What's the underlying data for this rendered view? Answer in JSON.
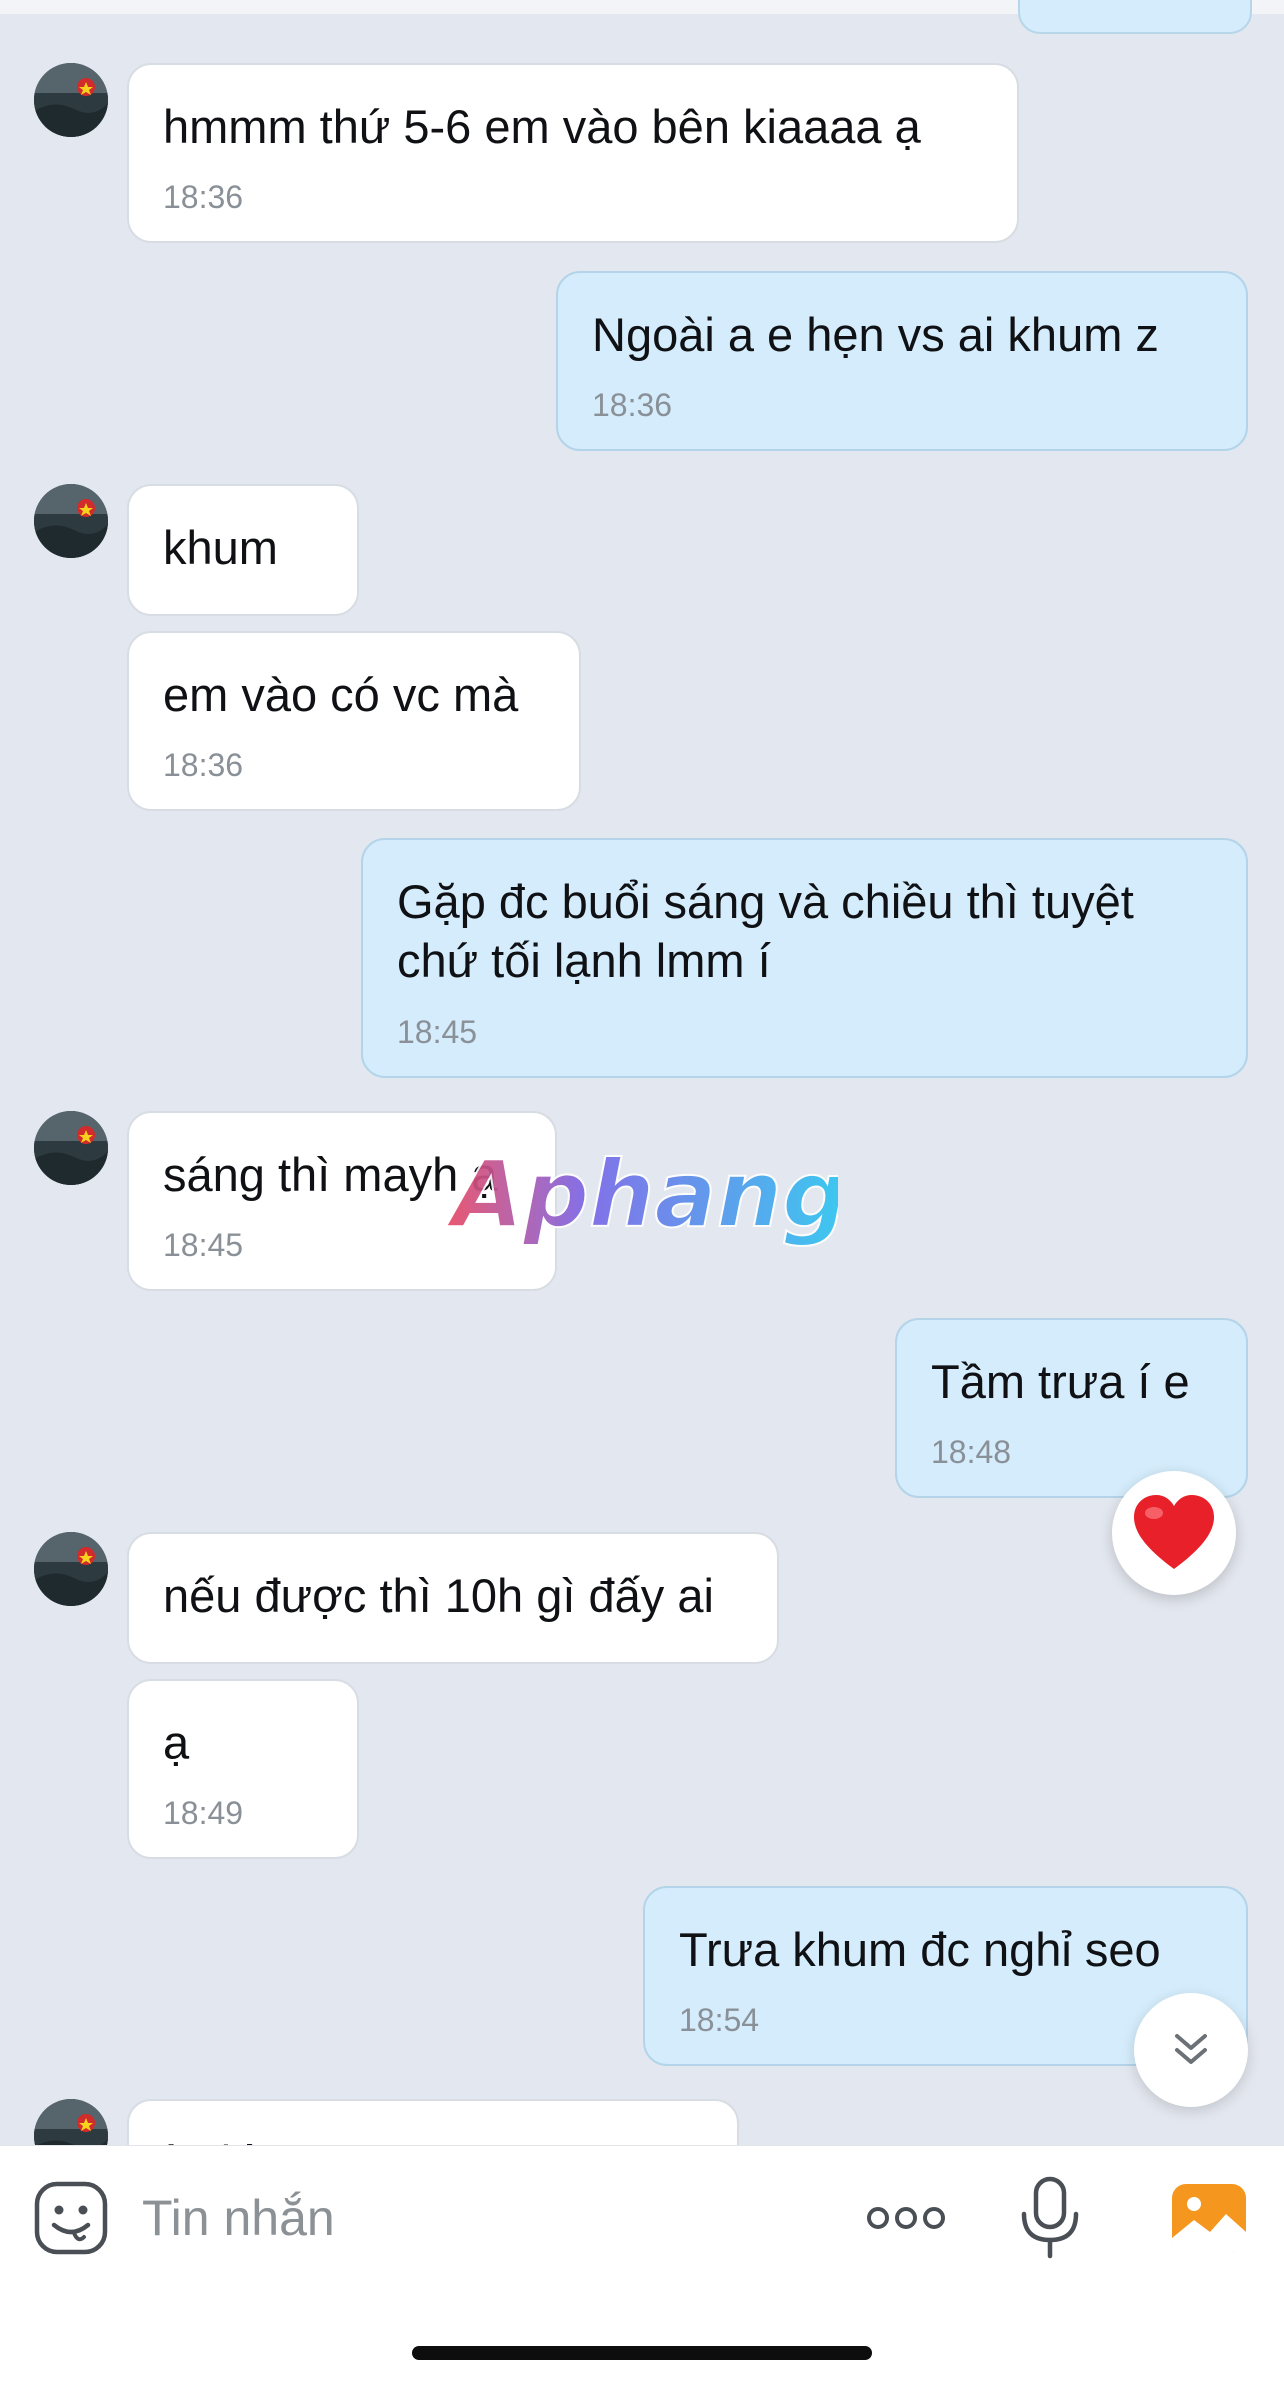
{
  "conversation": {
    "messages": [
      {
        "direction": "in",
        "text": "hmmm thứ 5-6 em vào bên kiaaaa ạ",
        "time": "18:36"
      },
      {
        "direction": "out",
        "text": "Ngoài a e hẹn vs ai khum z",
        "time": "18:36"
      },
      {
        "direction": "in",
        "text": "khum",
        "time": ""
      },
      {
        "direction": "in",
        "text": "em vào có vc mà",
        "time": "18:36"
      },
      {
        "direction": "out",
        "text": "Gặp đc buổi sáng và chiều thì tuyệt\nchứ tối lạnh lmm í",
        "time": "18:45"
      },
      {
        "direction": "in",
        "text": "sáng thì mayh ạ",
        "time": "18:45"
      },
      {
        "direction": "out",
        "text": "Tầm trưa í e",
        "time": "18:48"
      },
      {
        "direction": "in",
        "text": "nếu được thì 10h gì đấy ai",
        "time": ""
      },
      {
        "direction": "in",
        "text": "ạ",
        "time": "18:49"
      },
      {
        "direction": "out",
        "text": "Trưa khum đc nghỉ seo",
        "time": "18:54"
      },
      {
        "direction": "in",
        "text": "ừ thì ....",
        "time": ""
      }
    ],
    "reaction": {
      "icon": "heart-icon",
      "color": "#e8202a"
    },
    "watermark": {
      "text": "Aphang"
    }
  },
  "composer": {
    "placeholder": "Tin nhắn",
    "icons": {
      "emoji": "emoji-sticker-icon",
      "more": "more-options-icon",
      "mic": "microphone-icon",
      "photo": "photo-gallery-icon"
    }
  },
  "colors": {
    "background": "#e3e7ef",
    "incoming_bubble": "#ffffff",
    "outgoing_bubble": "#d4ecfb",
    "photo_icon": "#f5961e"
  }
}
